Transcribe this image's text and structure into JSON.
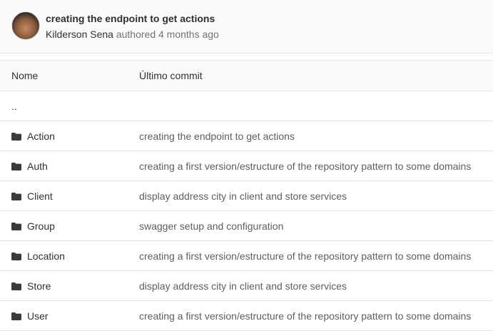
{
  "commit": {
    "title": "creating the endpoint to get actions",
    "author": "Kilderson Sena",
    "meta": "authored 4 months ago"
  },
  "table": {
    "headers": {
      "name": "Nome",
      "last_commit": "Último commit"
    },
    "parent": "..",
    "rows": [
      {
        "name": "Action",
        "commit": "creating the endpoint to get actions",
        "icon": "folder-icon"
      },
      {
        "name": "Auth",
        "commit": "creating a first version/estructure of the repository pattern to some domains",
        "icon": "folder-icon"
      },
      {
        "name": "Client",
        "commit": "display address city in client and store services",
        "icon": "folder-icon"
      },
      {
        "name": "Group",
        "commit": "swagger setup and configuration",
        "icon": "folder-icon"
      },
      {
        "name": "Location",
        "commit": "creating a first version/estructure of the repository pattern to some domains",
        "icon": "folder-icon"
      },
      {
        "name": "Store",
        "commit": "display address city in client and store services",
        "icon": "folder-icon"
      },
      {
        "name": "User",
        "commit": "creating a first version/estructure of the repository pattern to some domains",
        "icon": "folder-icon"
      }
    ]
  }
}
